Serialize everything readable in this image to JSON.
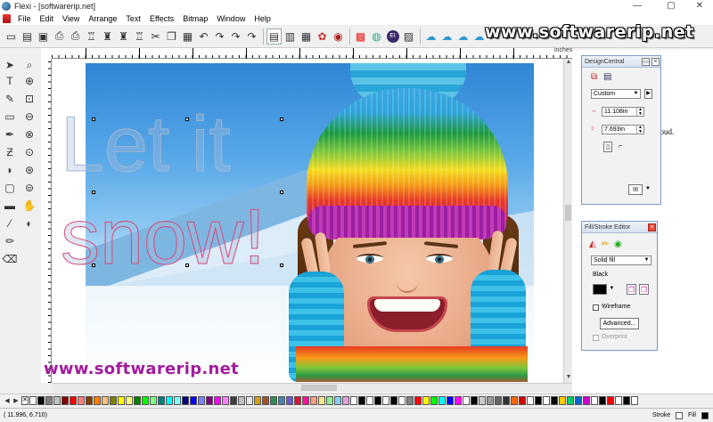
{
  "window": {
    "title": "Flexi - [softwarerip.net]",
    "controls": {
      "minimize": "—",
      "maximize": "▢",
      "close": "✕"
    }
  },
  "menu": {
    "items": [
      "File",
      "Edit",
      "View",
      "Arrange",
      "Text",
      "Effects",
      "Bitmap",
      "Window",
      "Help"
    ]
  },
  "toolbar": {
    "icons": [
      "new-icon",
      "open-icon",
      "save-icon",
      "print-icon",
      "print-preview-icon",
      "cut-tool-icon",
      "align-icon",
      "distribute-icon",
      "ungroup-icon",
      "scissors-icon",
      "copy-icon",
      "paste-icon",
      "undo-icon",
      "redo-icon",
      "redo-more-icon",
      "send-back-icon",
      "layers-icon",
      "production-icon",
      "color-wheel-icon",
      "spot-color-icon",
      "color-palette-icon",
      "spectrum-icon",
      "badge-icon",
      "hatch-icon",
      "cloud-icon",
      "cloud-upload-icon",
      "cloud-download-icon",
      "cloud-sync-icon",
      "grid-icon"
    ],
    "badge_label": "EI"
  },
  "watermark": {
    "top": "www.softwarerip.net",
    "bottom": "www.softwarerip.net"
  },
  "ruler": {
    "units": "inches",
    "corner_label": ""
  },
  "canvas": {
    "headline_line1": "Let it",
    "headline_line2": "snow!"
  },
  "doc_peek": {
    "text": "loud."
  },
  "design_central": {
    "title": "DesignCentral",
    "preset": "Custom",
    "width": "11.108in",
    "height": "7.693in"
  },
  "fill_stroke": {
    "title": "Fill/Stroke Editor",
    "fill_type": "Solid fill",
    "color_name": "Black",
    "wireframe_label": "Wireframe",
    "advanced_label": "Advanced...",
    "overprint_label": "Overprint"
  },
  "palette": {
    "colors": [
      "#ffffff",
      "#000000",
      "#808080",
      "#c0c0c0",
      "#7f0000",
      "#ff0000",
      "#ff7f7f",
      "#7f3f00",
      "#ff7f00",
      "#ffbf7f",
      "#7f7f00",
      "#ffff00",
      "#ffff7f",
      "#007f00",
      "#00ff00",
      "#7fff7f",
      "#007f7f",
      "#00ffff",
      "#7fffff",
      "#00007f",
      "#0000ff",
      "#7f7fff",
      "#7f007f",
      "#ff00ff",
      "#ff7fff",
      "#3f3f3f",
      "#bfbfbf",
      "#e6e6e6",
      "#d4a017",
      "#a0522d",
      "#2e8b57",
      "#4682b4",
      "#6a5acd",
      "#dc143c",
      "#ff1493",
      "#ffa07a",
      "#f0e68c",
      "#90ee90",
      "#87cefa",
      "#dda0dd",
      "#ffffff",
      "#000000",
      "#ffffff",
      "#000000",
      "#ffffff",
      "#000000",
      "#ffffff",
      "#808080",
      "#ff0000",
      "#ffff00",
      "#00ff00",
      "#00ffff",
      "#0000ff",
      "#ff00ff",
      "#ffffff",
      "#000000",
      "#cccccc",
      "#999999",
      "#666666",
      "#333333",
      "#ff6600",
      "#cc0000",
      "#ffffff",
      "#000000",
      "#ffffff",
      "#000000",
      "#ffcc00",
      "#00cc66",
      "#0066cc",
      "#cc00cc",
      "#ffffff",
      "#000000",
      "#ff0000",
      "#ffffff",
      "#000000",
      "#ffffff"
    ]
  },
  "status": {
    "coordinates": "( 11.996,    6.710)",
    "stroke_label": "Stroke",
    "fill_label": "Fill"
  },
  "colors": {
    "watermark_bottom": "#a21c9c",
    "panel_border": "#7a9ac8",
    "headline_stroke": "#9fb6d3",
    "headline_stroke_line2": "#d54a7a"
  }
}
